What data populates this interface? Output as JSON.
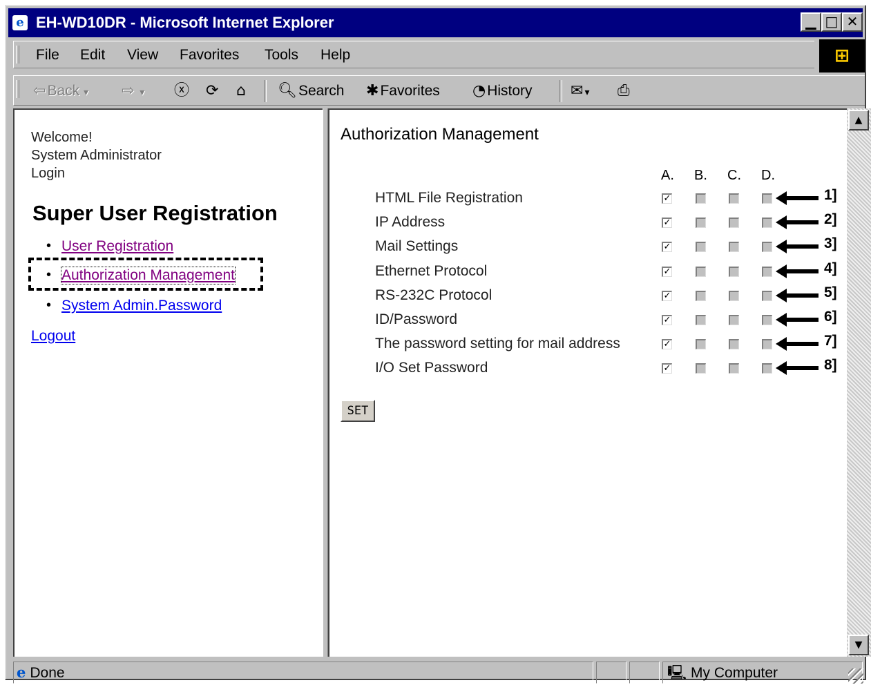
{
  "window": {
    "title": "EH-WD10DR - Microsoft Internet Explorer"
  },
  "title_buttons": {
    "minimize": "▁",
    "maximize": "□",
    "close": "✕"
  },
  "menu": [
    "File",
    "Edit",
    "View",
    "Favorites",
    "Tools",
    "Help"
  ],
  "toolbar": {
    "back": "Back",
    "search": "Search",
    "favorites": "Favorites",
    "history": "History"
  },
  "left": {
    "welcome": "Welcome!",
    "user": "System Administrator",
    "login": "Login",
    "heading": "Super User Registration",
    "links": [
      "User Registration",
      "Authorization Management",
      "System Admin.Password"
    ],
    "logout": "Logout"
  },
  "right": {
    "heading": "Authorization Management",
    "columns": [
      "A.",
      "B.",
      "C.",
      "D."
    ],
    "rows": [
      {
        "label": "HTML File Registration",
        "checked": [
          true,
          false,
          false,
          false
        ],
        "marker": "1]"
      },
      {
        "label": "IP Address",
        "checked": [
          true,
          false,
          false,
          false
        ],
        "marker": "2]"
      },
      {
        "label": "Mail Settings",
        "checked": [
          true,
          false,
          false,
          false
        ],
        "marker": "3]"
      },
      {
        "label": "Ethernet Protocol",
        "checked": [
          true,
          false,
          false,
          false
        ],
        "marker": "4]"
      },
      {
        "label": "RS-232C Protocol",
        "checked": [
          true,
          false,
          false,
          false
        ],
        "marker": "5]"
      },
      {
        "label": "ID/Password",
        "checked": [
          true,
          false,
          false,
          false
        ],
        "marker": "6]"
      },
      {
        "label": "The password setting for mail address",
        "checked": [
          true,
          false,
          false,
          false
        ],
        "marker": "7]"
      },
      {
        "label": "I/O Set Password",
        "checked": [
          true,
          false,
          false,
          false
        ],
        "marker": "8]"
      }
    ],
    "set_button": "SET"
  },
  "status": {
    "text": "Done",
    "zone": "My Computer"
  },
  "colors": {
    "titlebar": "#000080",
    "chrome": "#c0c0c0",
    "link": "#0000ee",
    "visited_link": "#800080"
  }
}
